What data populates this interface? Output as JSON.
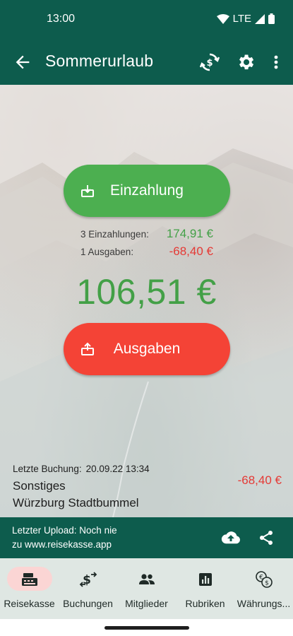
{
  "status_bar": {
    "time": "13:00",
    "network": "LTE",
    "icons": [
      "wifi-icon",
      "signal-icon",
      "battery-icon"
    ]
  },
  "app_bar": {
    "title": "Sommerurlaub",
    "icons": [
      "back-arrow-icon",
      "sync-currency-icon",
      "gear-icon",
      "more-vert-icon"
    ]
  },
  "actions": {
    "deposit_label": "Einzahlung",
    "expense_label": "Ausgaben",
    "deposit_color": "#4caf50",
    "expense_color": "#f44336"
  },
  "summary": {
    "deposits_label": "3 Einzahlungen:",
    "deposits_value": "174,91 €",
    "expenses_label": "1 Ausgaben:",
    "expenses_value": "-68,40 €",
    "balance": "106,51 €"
  },
  "last_booking": {
    "label": "Letzte Buchung:",
    "datetime": "20.09.22 13:34",
    "category": "Sonstiges",
    "description": "Würzburg Stadtbummel",
    "amount": "-68,40 €"
  },
  "upload": {
    "line1": "Letzter Upload: Noch nie",
    "line2": "zu www.reisekasse.app",
    "icons": [
      "cloud-upload-icon",
      "share-icon"
    ]
  },
  "nav": {
    "items": [
      {
        "label": "Reisekasse",
        "icon": "cash-register-icon",
        "active": true
      },
      {
        "label": "Buchungen",
        "icon": "transactions-icon",
        "active": false
      },
      {
        "label": "Mitglieder",
        "icon": "group-icon",
        "active": false
      },
      {
        "label": "Rubriken",
        "icon": "bar-chart-icon",
        "active": false
      },
      {
        "label": "Währungs...",
        "icon": "currency-exchange-icon",
        "active": false
      }
    ]
  },
  "colors": {
    "primary": "#0d5c4d",
    "positive": "#43a047",
    "negative": "#e53935",
    "nav_bg": "#dfe7e3",
    "active_pill": "#fbd5d4"
  }
}
